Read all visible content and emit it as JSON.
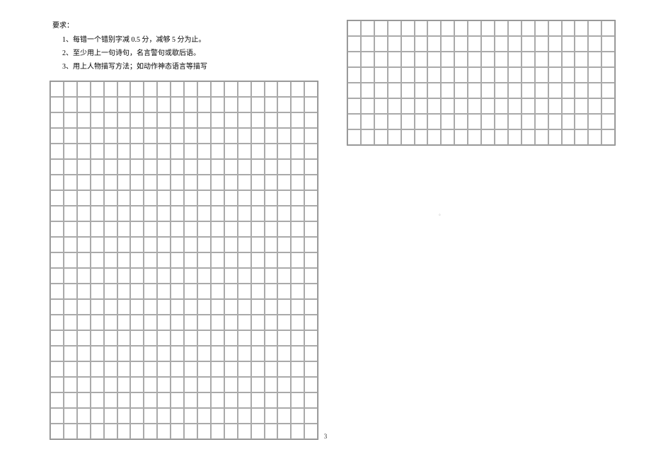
{
  "instructions": {
    "heading": "要求：",
    "items": [
      "1、每错一个错别字减 0.5 分，减够 5 分为止。",
      "2、至少用上一句诗句，名言警句或歇后语。",
      "3、用上人物描写方法；如动作神态语言等描写"
    ]
  },
  "grid": {
    "leftRows": 23,
    "rightRows": 8,
    "cols": 20
  },
  "pageNumber": "3",
  "tinyMark": "。"
}
